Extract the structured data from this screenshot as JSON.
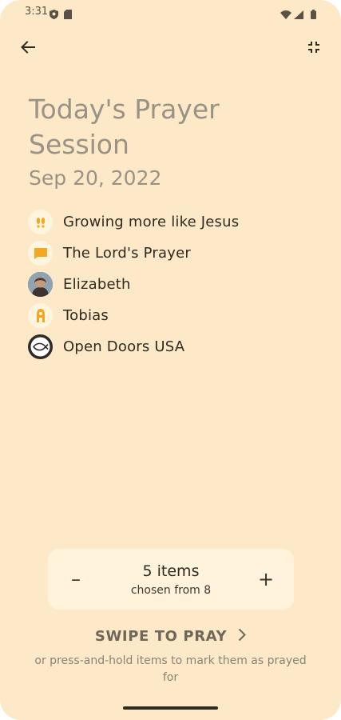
{
  "status_bar": {
    "time": "3:31",
    "icons": [
      "shield-icon",
      "sd-card-icon",
      "wifi-icon",
      "signal-icon",
      "battery-icon"
    ]
  },
  "top_bar": {
    "back_icon": "arrow-left-icon",
    "collapse_icon": "fullscreen-exit-icon"
  },
  "session": {
    "title": "Today's Prayer Session",
    "date": "Sep 20, 2022"
  },
  "items": [
    {
      "label": "Growing more like Jesus",
      "icon": "footprints-icon"
    },
    {
      "label": "The Lord's Prayer",
      "icon": "message-icon"
    },
    {
      "label": "Elizabeth",
      "icon": "avatar-photo"
    },
    {
      "label": "Tobias",
      "icon": "person-icon"
    },
    {
      "label": "Open Doors USA",
      "icon": "ichthys-logo"
    }
  ],
  "stepper": {
    "count_text": "5 items",
    "sub_text": "chosen from 8",
    "minus_label": "–",
    "plus_label": "+"
  },
  "swipe": {
    "label": "SWIPE TO PRAY",
    "hint": "or press-and-hold items to mark them as prayed for"
  },
  "colors": {
    "background": "#fde9c8",
    "card": "#fff3dc",
    "accent": "#f5a623",
    "muted_text": "#9a9284"
  }
}
